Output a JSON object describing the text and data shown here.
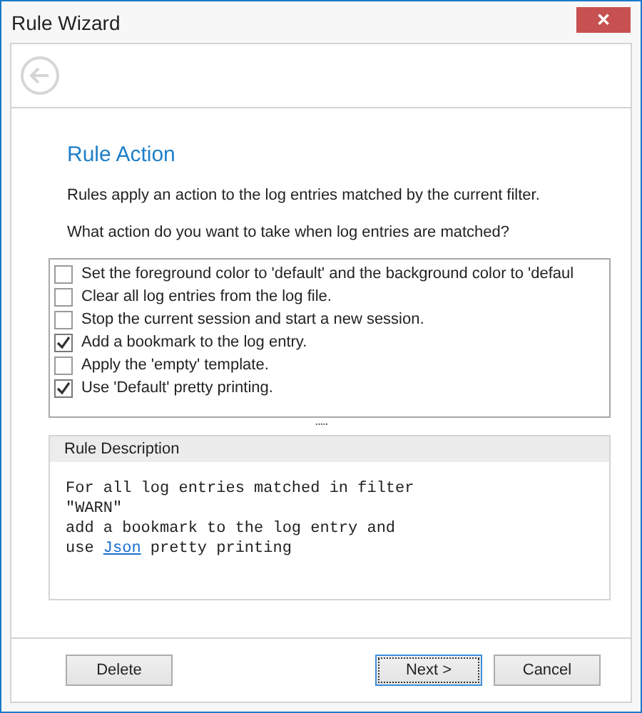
{
  "window": {
    "title": "Rule Wizard",
    "close_glyph": "✕"
  },
  "page": {
    "heading": "Rule Action",
    "intro": "Rules apply an action to the log entries matched by the current filter.",
    "question": "What action do you want to take when log entries are matched?"
  },
  "actions": [
    {
      "label": "Set the foreground color to 'default' and the background color to 'defaul",
      "checked": false
    },
    {
      "label": "Clear all log entries from the log file.",
      "checked": false
    },
    {
      "label": "Stop the current session and start a new session.",
      "checked": false
    },
    {
      "label": "Add a bookmark to the log entry.",
      "checked": true
    },
    {
      "label": "Apply the 'empty' template.",
      "checked": false
    },
    {
      "label": "Use 'Default' pretty printing.",
      "checked": true
    }
  ],
  "splitter_glyph": ".....",
  "description": {
    "title": "Rule Description",
    "lines": [
      {
        "kind": "text",
        "text": "For all log entries matched in filter"
      },
      {
        "kind": "text",
        "text": "\"WARN\""
      },
      {
        "kind": "text",
        "text": "add a bookmark to the log entry and"
      },
      {
        "kind": "link",
        "before": "use ",
        "link": "Json",
        "after": " pretty printing"
      }
    ]
  },
  "buttons": {
    "delete": "Delete",
    "next": "Next >",
    "cancel": "Cancel"
  }
}
